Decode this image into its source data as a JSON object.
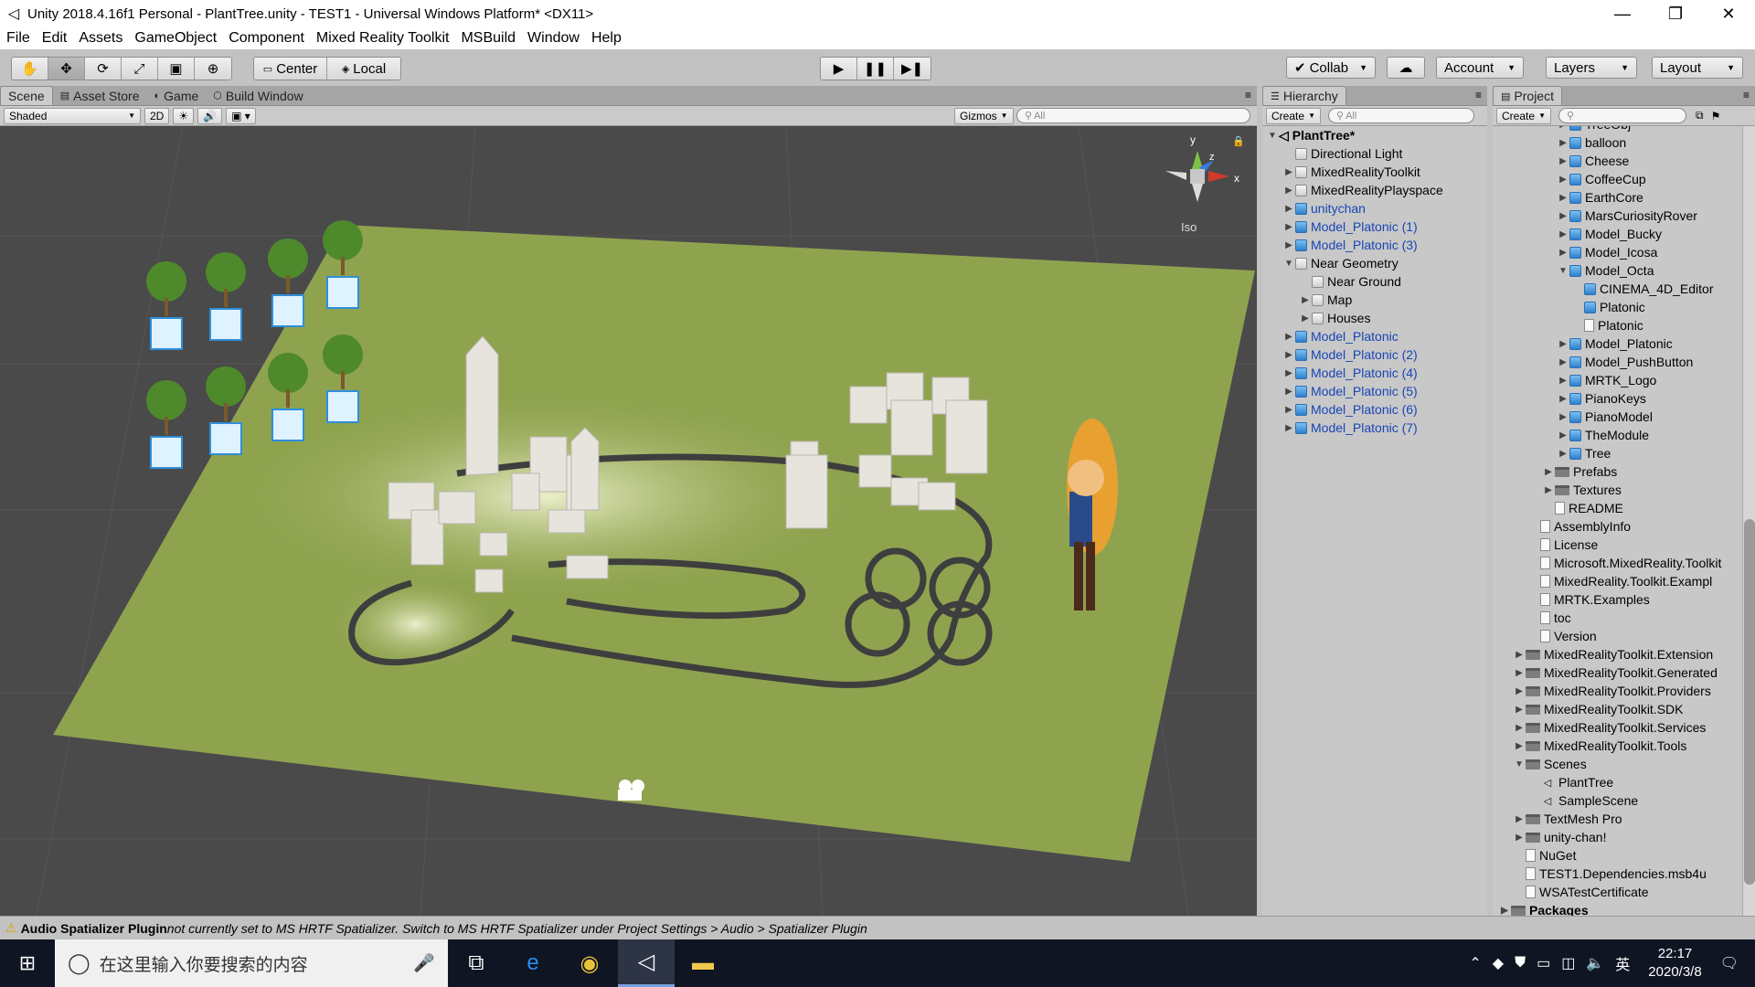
{
  "window": {
    "title": "Unity 2018.4.16f1 Personal - PlantTree.unity - TEST1 - Universal Windows Platform* <DX11>",
    "controls": [
      "—",
      "❐",
      "✕"
    ]
  },
  "menu": [
    "File",
    "Edit",
    "Assets",
    "GameObject",
    "Component",
    "Mixed Reality Toolkit",
    "MSBuild",
    "Window",
    "Help"
  ],
  "toolbar": {
    "pivot_center": "Center",
    "pivot_local": "Local",
    "collab": "Collab",
    "account": "Account",
    "layers": "Layers",
    "layout": "Layout"
  },
  "scene_tabs": [
    "Scene",
    "Asset Store",
    "Game",
    "Build Window"
  ],
  "scene_bar": {
    "shading": "Shaded",
    "mode_2d": "2D",
    "gizmos": "Gizmos",
    "search_placeholder": "All"
  },
  "gizmo": {
    "x": "x",
    "y": "y",
    "z": "z",
    "projection": "Iso"
  },
  "hierarchy": {
    "tab": "Hierarchy",
    "create": "Create",
    "search_placeholder": "All",
    "root": "PlantTree*",
    "items": [
      {
        "label": "Directional Light",
        "indent": 1,
        "arrow": "",
        "prefab": false
      },
      {
        "label": "MixedRealityToolkit",
        "indent": 1,
        "arrow": "▶",
        "prefab": false
      },
      {
        "label": "MixedRealityPlayspace",
        "indent": 1,
        "arrow": "▶",
        "prefab": false
      },
      {
        "label": "unitychan",
        "indent": 1,
        "arrow": "▶",
        "prefab": true
      },
      {
        "label": "Model_Platonic (1)",
        "indent": 1,
        "arrow": "▶",
        "prefab": true
      },
      {
        "label": "Model_Platonic (3)",
        "indent": 1,
        "arrow": "▶",
        "prefab": true
      },
      {
        "label": "Near Geometry",
        "indent": 1,
        "arrow": "▼",
        "prefab": false
      },
      {
        "label": "Near Ground",
        "indent": 2,
        "arrow": "",
        "prefab": false
      },
      {
        "label": "Map",
        "indent": 2,
        "arrow": "▶",
        "prefab": false
      },
      {
        "label": "Houses",
        "indent": 2,
        "arrow": "▶",
        "prefab": false
      },
      {
        "label": "Model_Platonic",
        "indent": 1,
        "arrow": "▶",
        "prefab": true
      },
      {
        "label": "Model_Platonic (2)",
        "indent": 1,
        "arrow": "▶",
        "prefab": true
      },
      {
        "label": "Model_Platonic (4)",
        "indent": 1,
        "arrow": "▶",
        "prefab": true
      },
      {
        "label": "Model_Platonic (5)",
        "indent": 1,
        "arrow": "▶",
        "prefab": true
      },
      {
        "label": "Model_Platonic (6)",
        "indent": 1,
        "arrow": "▶",
        "prefab": true
      },
      {
        "label": "Model_Platonic (7)",
        "indent": 1,
        "arrow": "▶",
        "prefab": true
      }
    ]
  },
  "project": {
    "tab": "Project",
    "create": "Create",
    "items": [
      {
        "label": "TreeObj",
        "indent": 4,
        "arrow": "▶",
        "icon": "prefab"
      },
      {
        "label": "balloon",
        "indent": 4,
        "arrow": "▶",
        "icon": "prefab"
      },
      {
        "label": "Cheese",
        "indent": 4,
        "arrow": "▶",
        "icon": "prefab"
      },
      {
        "label": "CoffeeCup",
        "indent": 4,
        "arrow": "▶",
        "icon": "prefab"
      },
      {
        "label": "EarthCore",
        "indent": 4,
        "arrow": "▶",
        "icon": "prefab"
      },
      {
        "label": "MarsCuriosityRover",
        "indent": 4,
        "arrow": "▶",
        "icon": "prefab"
      },
      {
        "label": "Model_Bucky",
        "indent": 4,
        "arrow": "▶",
        "icon": "prefab"
      },
      {
        "label": "Model_Icosa",
        "indent": 4,
        "arrow": "▶",
        "icon": "prefab"
      },
      {
        "label": "Model_Octa",
        "indent": 4,
        "arrow": "▼",
        "icon": "prefab"
      },
      {
        "label": "CINEMA_4D_Editor",
        "indent": 5,
        "arrow": "",
        "icon": "prefab"
      },
      {
        "label": "Platonic",
        "indent": 5,
        "arrow": "",
        "icon": "prefab"
      },
      {
        "label": "Platonic",
        "indent": 5,
        "arrow": "",
        "icon": "file"
      },
      {
        "label": "Model_Platonic",
        "indent": 4,
        "arrow": "▶",
        "icon": "prefab"
      },
      {
        "label": "Model_PushButton",
        "indent": 4,
        "arrow": "▶",
        "icon": "prefab"
      },
      {
        "label": "MRTK_Logo",
        "indent": 4,
        "arrow": "▶",
        "icon": "prefab"
      },
      {
        "label": "PianoKeys",
        "indent": 4,
        "arrow": "▶",
        "icon": "prefab"
      },
      {
        "label": "PianoModel",
        "indent": 4,
        "arrow": "▶",
        "icon": "prefab"
      },
      {
        "label": "TheModule",
        "indent": 4,
        "arrow": "▶",
        "icon": "prefab"
      },
      {
        "label": "Tree",
        "indent": 4,
        "arrow": "▶",
        "icon": "prefab"
      },
      {
        "label": "Prefabs",
        "indent": 3,
        "arrow": "▶",
        "icon": "folder"
      },
      {
        "label": "Textures",
        "indent": 3,
        "arrow": "▶",
        "icon": "folder"
      },
      {
        "label": "README",
        "indent": 3,
        "arrow": "",
        "icon": "file"
      },
      {
        "label": "AssemblyInfo",
        "indent": 2,
        "arrow": "",
        "icon": "file"
      },
      {
        "label": "License",
        "indent": 2,
        "arrow": "",
        "icon": "file"
      },
      {
        "label": "Microsoft.MixedReality.Toolkit",
        "indent": 2,
        "arrow": "",
        "icon": "file"
      },
      {
        "label": "MixedReality.Toolkit.Exampl",
        "indent": 2,
        "arrow": "",
        "icon": "file"
      },
      {
        "label": "MRTK.Examples",
        "indent": 2,
        "arrow": "",
        "icon": "file"
      },
      {
        "label": "toc",
        "indent": 2,
        "arrow": "",
        "icon": "file"
      },
      {
        "label": "Version",
        "indent": 2,
        "arrow": "",
        "icon": "file"
      },
      {
        "label": "MixedRealityToolkit.Extension",
        "indent": 1,
        "arrow": "▶",
        "icon": "folder"
      },
      {
        "label": "MixedRealityToolkit.Generated",
        "indent": 1,
        "arrow": "▶",
        "icon": "folder"
      },
      {
        "label": "MixedRealityToolkit.Providers",
        "indent": 1,
        "arrow": "▶",
        "icon": "folder"
      },
      {
        "label": "MixedRealityToolkit.SDK",
        "indent": 1,
        "arrow": "▶",
        "icon": "folder"
      },
      {
        "label": "MixedRealityToolkit.Services",
        "indent": 1,
        "arrow": "▶",
        "icon": "folder"
      },
      {
        "label": "MixedRealityToolkit.Tools",
        "indent": 1,
        "arrow": "▶",
        "icon": "folder"
      },
      {
        "label": "Scenes",
        "indent": 1,
        "arrow": "▼",
        "icon": "folder"
      },
      {
        "label": "PlantTree",
        "indent": 2,
        "arrow": "",
        "icon": "unity"
      },
      {
        "label": "SampleScene",
        "indent": 2,
        "arrow": "",
        "icon": "unity"
      },
      {
        "label": "TextMesh Pro",
        "indent": 1,
        "arrow": "▶",
        "icon": "folder"
      },
      {
        "label": "unity-chan!",
        "indent": 1,
        "arrow": "▶",
        "icon": "folder"
      },
      {
        "label": "NuGet",
        "indent": 1,
        "arrow": "",
        "icon": "file"
      },
      {
        "label": "TEST1.Dependencies.msb4u",
        "indent": 1,
        "arrow": "",
        "icon": "file"
      },
      {
        "label": "WSATestCertificate",
        "indent": 1,
        "arrow": "",
        "icon": "file"
      },
      {
        "label": "Packages",
        "indent": 0,
        "arrow": "▶",
        "icon": "folder"
      }
    ]
  },
  "status": {
    "bold": "Audio Spatializer Plugin",
    "message": " not currently set to MS HRTF Spatializer. Switch to MS HRTF Spatializer under Project Settings > Audio > Spatializer Plugin"
  },
  "taskbar": {
    "search_placeholder": "在这里输入你要搜索的内容",
    "time": "22:17",
    "date": "2020/3/8",
    "ime": "英"
  }
}
